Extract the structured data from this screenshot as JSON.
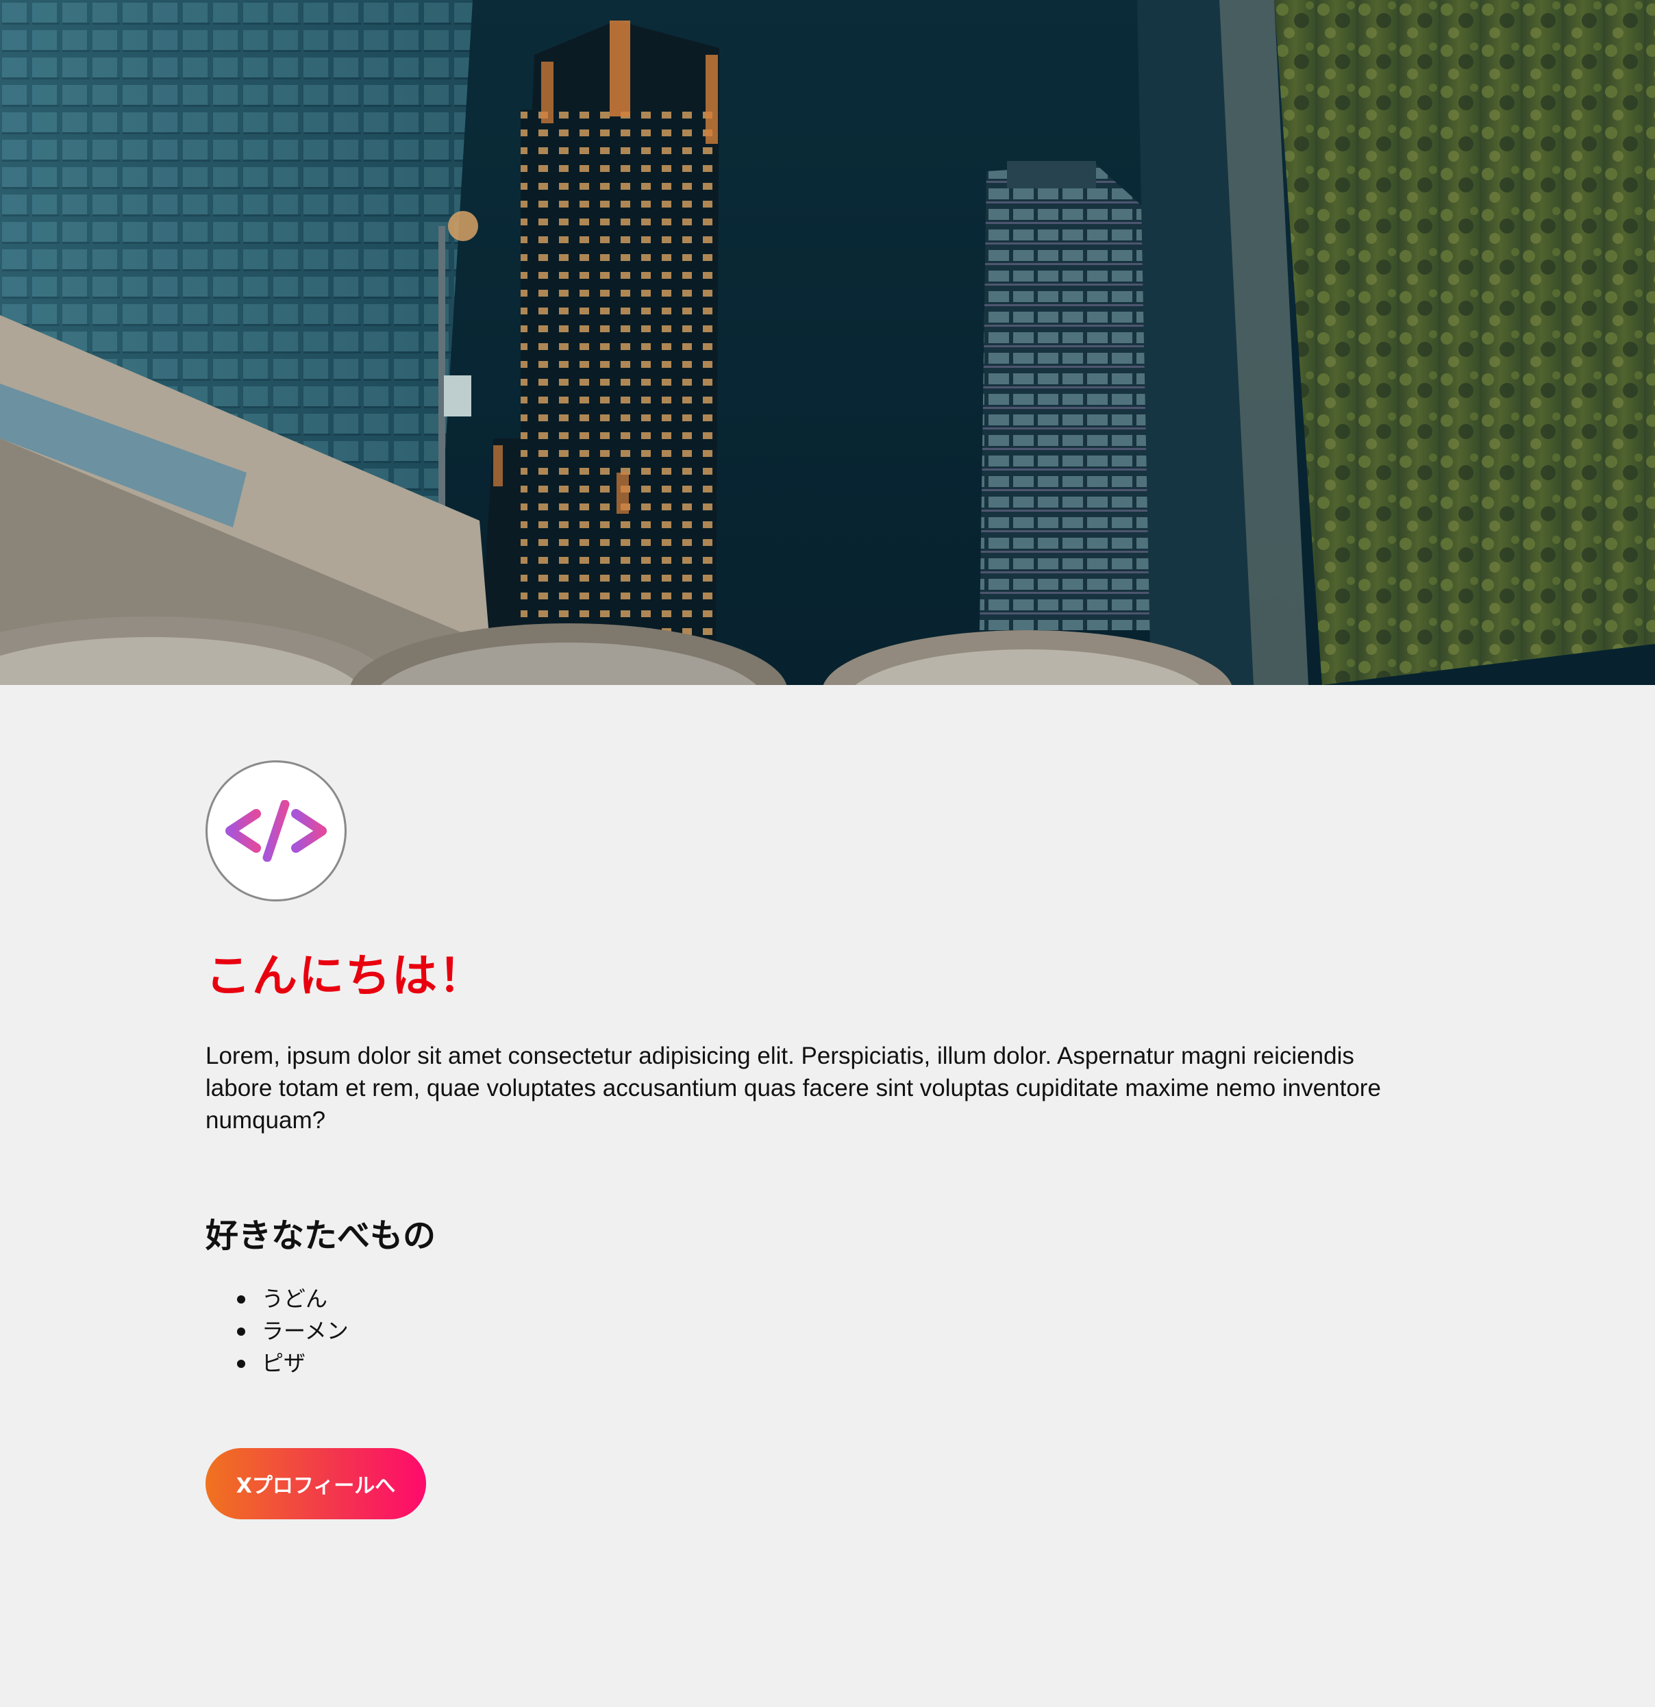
{
  "hero": {
    "image_subject": "night city skyline photo",
    "colors": {
      "sky": "#0a2432",
      "glass": "#2c5c6c",
      "warm_light": "#e89a4a",
      "foliage": "#5c6b2c"
    }
  },
  "avatar": {
    "icon": "code-icon",
    "colors": {
      "left": "#a855d8",
      "right": "#e04aa0"
    }
  },
  "greeting": {
    "text": "こんにちは！",
    "color": "#e8000f"
  },
  "intro": {
    "text": "Lorem, ipsum dolor sit amet consectetur adipisicing elit. Perspiciatis, illum dolor. Aspernatur magni reiciendis labore totam et rem, quae voluptates accusantium quas facere sint voluptas cupiditate maxime nemo inventore numquam?"
  },
  "favorite_foods": {
    "heading": "好きなたべもの",
    "items": [
      "うどん",
      "ラーメン",
      "ピザ"
    ]
  },
  "profile_button": {
    "label": "Xプロフィールへ",
    "colors": {
      "start": "#f0731f",
      "end": "#ff0a6c"
    }
  },
  "background": "#f0f0f0"
}
